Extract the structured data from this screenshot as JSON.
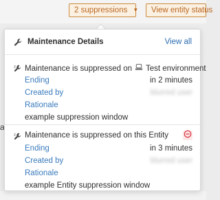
{
  "toolbar": {
    "suppressions_label": "2 suppressions",
    "status_label": "View entity status"
  },
  "popover": {
    "title": "Maintenance Details",
    "view_all": "View all",
    "entries": [
      {
        "title_prefix": "Maintenance is suppressed on",
        "target": "Test environment",
        "ending_label": "Ending",
        "ending_value": "in 2 minutes",
        "created_label": "Created by",
        "created_value": "blurred user",
        "rationale_label": "Rationale",
        "rationale_value": "example suppression window"
      },
      {
        "title": "Maintenance is suppressed on this Entity",
        "ending_label": "Ending",
        "ending_value": "in 3 minutes",
        "created_label": "Created by",
        "created_value": "blurred user",
        "rationale_label": "Rationale",
        "rationale_value": "example Entity suppression window"
      }
    ]
  },
  "background": {
    "left_glyph": "a"
  },
  "colors": {
    "accent_orange": "#b9651d",
    "link_blue": "#2b6cb0",
    "label_blue": "#3a7bbd",
    "danger_red": "#d9363e"
  }
}
